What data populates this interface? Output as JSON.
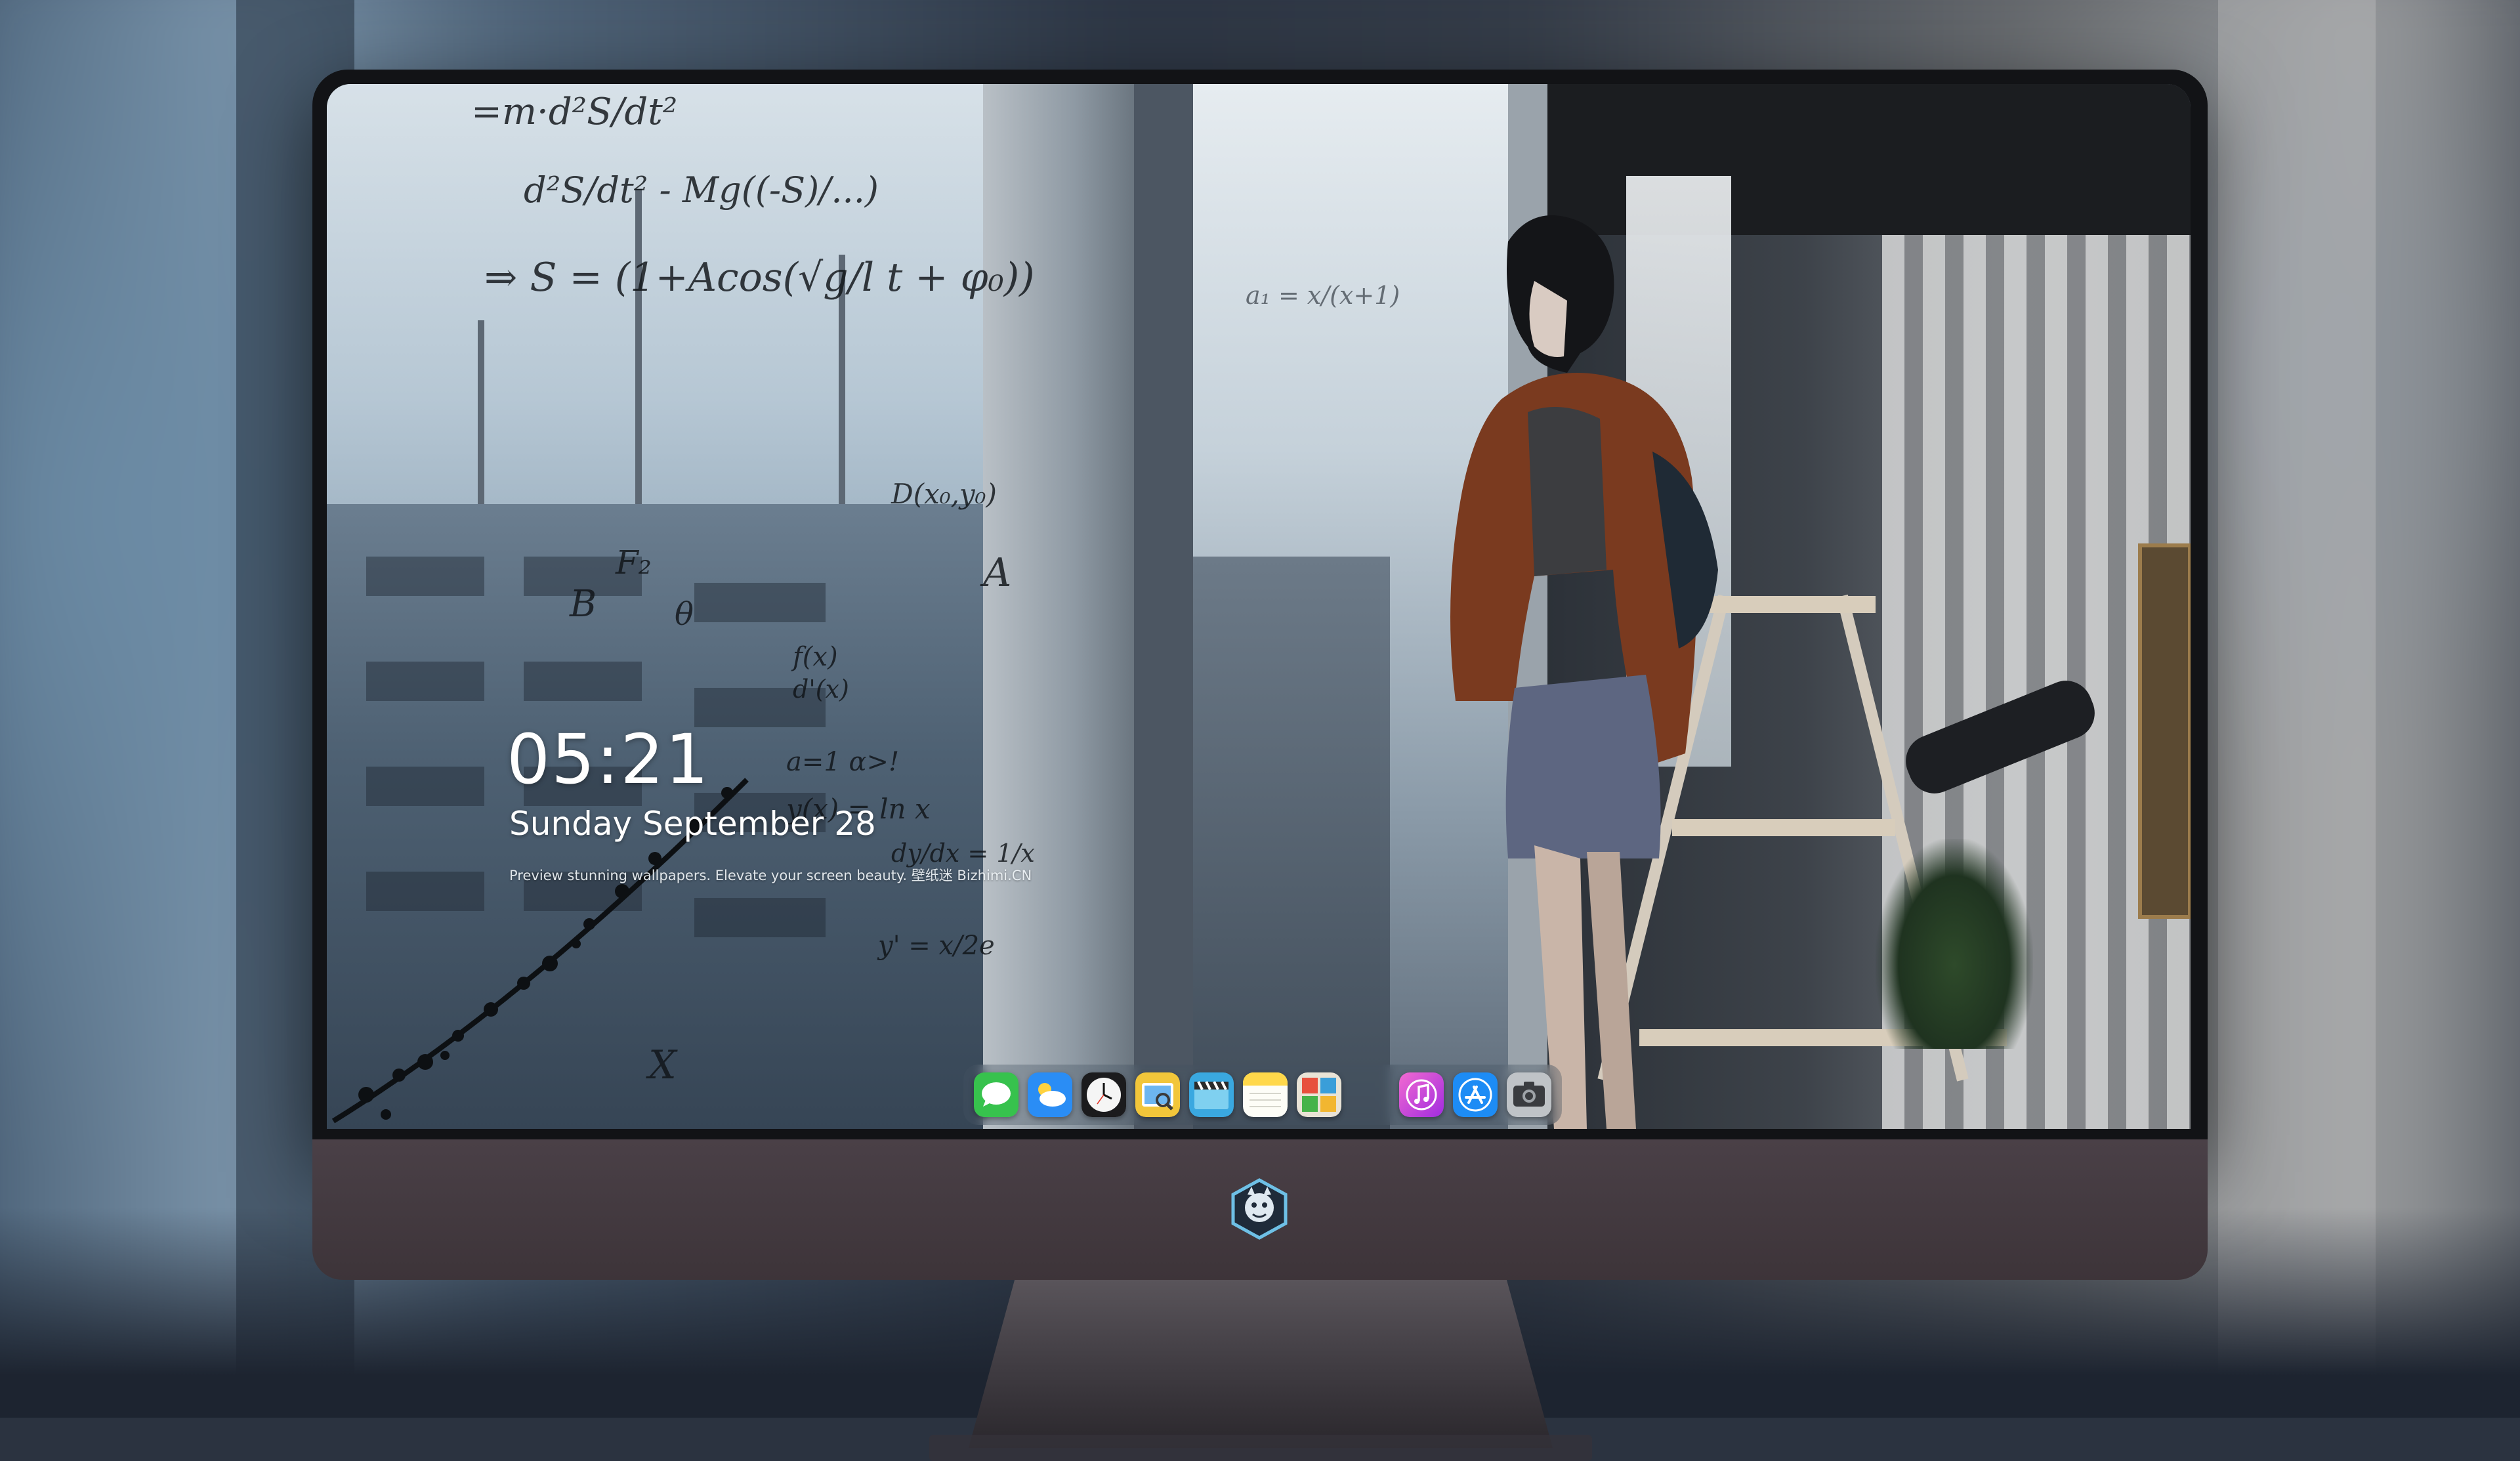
{
  "lock_screen": {
    "time": "05:21",
    "date": "Sunday September  28",
    "tagline": "Preview stunning wallpapers. Elevate your screen beauty. 壁纸迷 Bizhimi.CN"
  },
  "dock": {
    "apps": [
      {
        "name": "Messages",
        "icon": "messages-icon",
        "color": "#37c24d"
      },
      {
        "name": "Weather",
        "icon": "weather-icon",
        "color": "#2a8df5"
      },
      {
        "name": "Clock",
        "icon": "clock-icon",
        "color": "#f5f5f5"
      },
      {
        "name": "Preview",
        "icon": "preview-icon",
        "color": "#f2c63a"
      },
      {
        "name": "Clips",
        "icon": "clips-icon",
        "color": "#3aa8e0"
      },
      {
        "name": "Notes",
        "icon": "notes-icon",
        "color": "#ffd84a"
      },
      {
        "name": "Photo Booth",
        "icon": "photo-booth-icon",
        "color": "#e7503d"
      },
      {
        "name": "iTunes",
        "icon": "itunes-icon",
        "color": "#d13ad6"
      },
      {
        "name": "App Store",
        "icon": "app-store-icon",
        "color": "#1d8cf5"
      },
      {
        "name": "Camera",
        "icon": "camera-icon",
        "color": "#9ea3a8"
      }
    ]
  },
  "wallpaper": {
    "formulas": [
      "=m·d²S/dt²",
      "d²S/dt² - Mg((-S)/...)",
      "⇒ S = (1+Acos(√g/l t + φ₀))",
      "D(x₀,y₀)",
      "A",
      "B",
      "F₂",
      "θ",
      "f(x)",
      "d'(x)",
      "a=1 α>!",
      "y(x) = ln x",
      "dy/dx = 1/x",
      "y' = x/2e",
      "X",
      "a₁ = x/(x+1)"
    ]
  },
  "colors": {
    "chin": "#4a4047",
    "bezel": "#121316",
    "clock_text": "#ffffff"
  }
}
